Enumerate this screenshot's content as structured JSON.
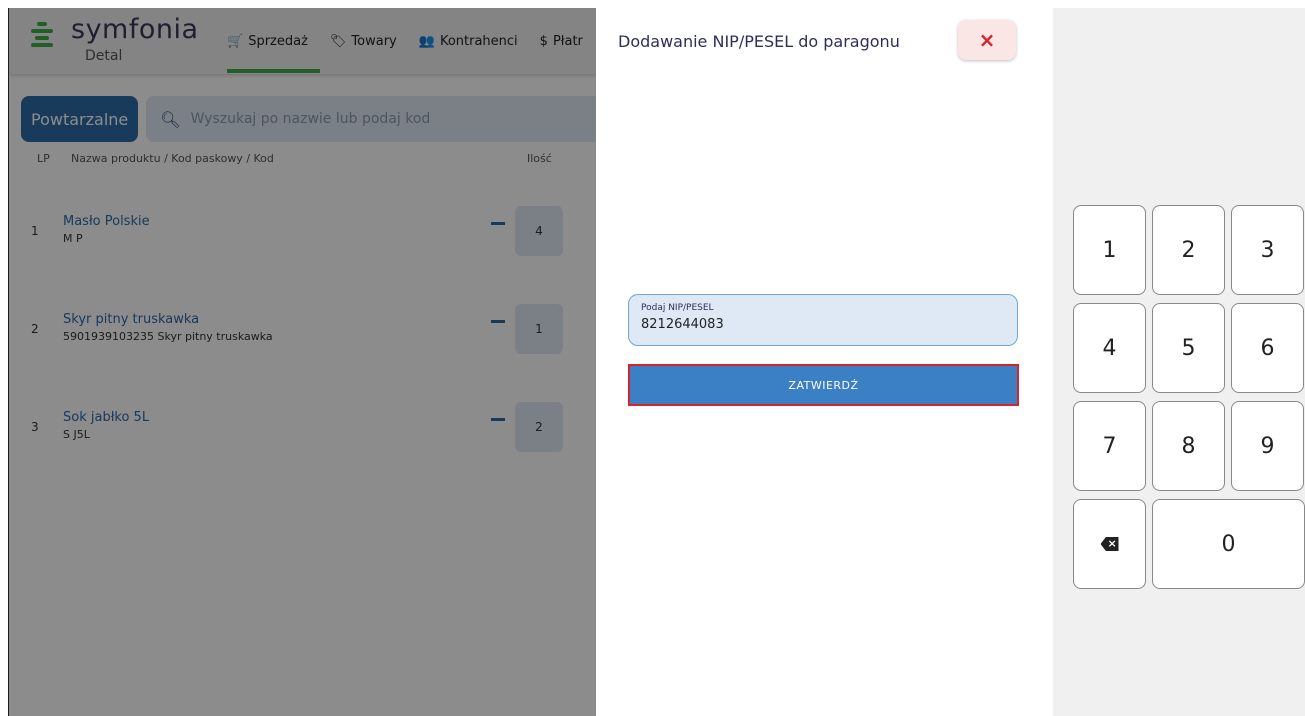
{
  "brand": {
    "name": "symfonia",
    "sub": "Detal",
    "accent": "#3fae49"
  },
  "nav": [
    {
      "label": "Sprzedaż",
      "icon": "cart-icon",
      "glyph": "🛒"
    },
    {
      "label": "Towary",
      "icon": "tag-icon",
      "glyph": "🏷"
    },
    {
      "label": "Kontrahenci",
      "icon": "contacts-icon",
      "glyph": "👥"
    },
    {
      "label": "Płatr",
      "icon": "dollar-icon",
      "glyph": "$"
    }
  ],
  "toolbar": {
    "repeat_label": "Powtarzalne",
    "search_placeholder": "Wyszukaj po nazwie lub podaj kod"
  },
  "columns": {
    "lp": "LP",
    "name": "Nazwa produktu / Kod paskowy / Kod",
    "qty": "Ilość"
  },
  "rows": [
    {
      "lp": "1",
      "name": "Masło Polskie",
      "code": "M P",
      "qty": "4"
    },
    {
      "lp": "2",
      "name": "Skyr pitny truskawka",
      "code": "5901939103235 Skyr pitny truskawka",
      "qty": "1"
    },
    {
      "lp": "3",
      "name": "Sok jabłko 5L",
      "code": "S J5L",
      "qty": "2"
    }
  ],
  "dialog": {
    "title": "Dodawanie NIP/PESEL do paragonu",
    "close_label": "×",
    "field_label": "Podaj NIP/PESEL",
    "field_value": "8212644083",
    "confirm_label": "ZATWIERDŹ",
    "close_color": "#d6242e",
    "confirm_color": "#3b7fc4"
  },
  "keypad": {
    "keys": [
      "1",
      "2",
      "3",
      "4",
      "5",
      "6",
      "7",
      "8",
      "9",
      "0"
    ],
    "backspace_icon": "backspace-icon"
  }
}
